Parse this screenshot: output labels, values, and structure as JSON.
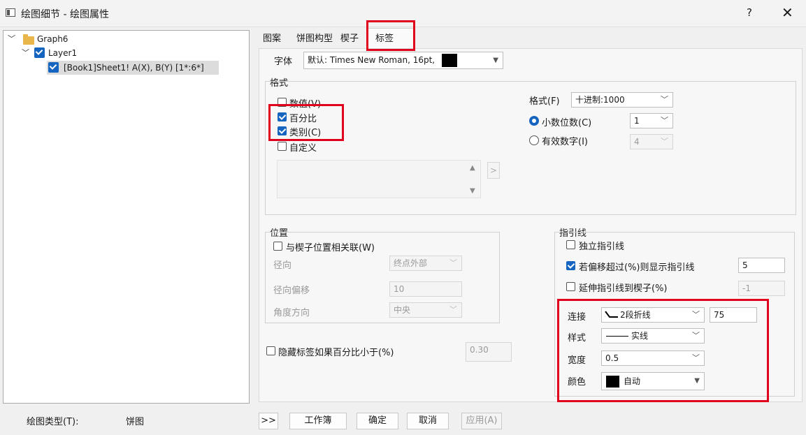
{
  "window": {
    "title": "绘图细节 - 绘图属性",
    "help": "?",
    "close": "✕"
  },
  "tree": {
    "graph": "Graph6",
    "layer": "Layer1",
    "plot": "[Book1]Sheet1! A(X), B(Y) [1*:6*]"
  },
  "tabs": [
    "图案",
    "饼图构型",
    "楔子",
    "标签"
  ],
  "font": {
    "label": "字体",
    "value": "默认: Times New Roman, 16pt,"
  },
  "format_group": {
    "title": "格式",
    "value_cb": "数值(V)",
    "percent_cb": "百分比",
    "category_cb": "类别(C)",
    "custom_cb": "自定义",
    "format_label": "格式(F)",
    "format_value": "十进制:1000",
    "decimal_label": "小数位数(C)",
    "decimal_value": "1",
    "sig_label": "有效数字(I)",
    "sig_value": "4"
  },
  "position_group": {
    "title": "位置",
    "link_cb": "与楔子位置相关联(W)",
    "radial_label": "径向",
    "radial_value": "终点外部",
    "offset_label": "径向偏移",
    "offset_value": "10",
    "angle_label": "角度方向",
    "angle_value": "中央"
  },
  "hide": {
    "label": "隐藏标签如果百分比小于(%)",
    "value": "0.30"
  },
  "leader_group": {
    "title": "指引线",
    "independent_cb": "独立指引线",
    "offset_cb": "若偏移超过(%)则显示指引线",
    "offset_value": "5",
    "extend_cb": "延伸指引线到楔子(%)",
    "extend_value": "-1",
    "connect_label": "连接",
    "connect_value": "2段折线",
    "connect_num": "75",
    "style_label": "样式",
    "style_value": "实线",
    "width_label": "宽度",
    "width_value": "0.5",
    "color_label": "颜色",
    "color_value": "自动"
  },
  "bottom": {
    "plot_type_label": "绘图类型(T):",
    "plot_type_value": "饼图",
    "expand": ">>",
    "workbook": "工作簿",
    "ok": "确定",
    "cancel": "取消",
    "apply": "应用(A)"
  },
  "colors": {
    "accent": "#1565c0",
    "highlight": "#e0001b"
  }
}
